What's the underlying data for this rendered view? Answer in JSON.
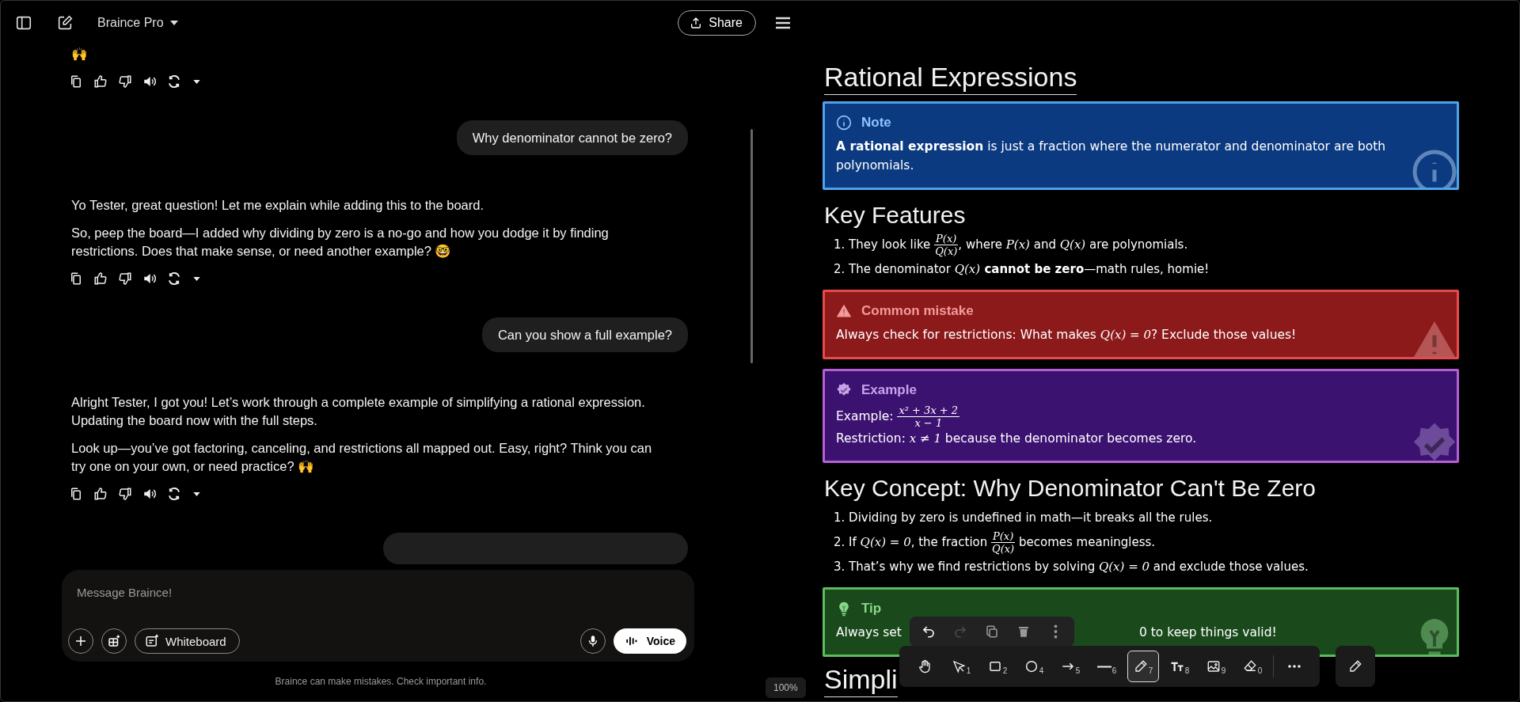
{
  "header": {
    "model": "Braince Pro",
    "share": "Share"
  },
  "messages": [
    {
      "kind": "assistant",
      "paragraphs": [
        "🙌"
      ]
    },
    {
      "kind": "user",
      "text": "Why denominator cannot be zero?"
    },
    {
      "kind": "assistant",
      "paragraphs": [
        "Yo Tester, great question! Let me explain while adding this to the board.",
        "So, peep the board—I added why dividing by zero is a no-go and how you dodge it by finding restrictions. Does that make sense, or need another example? 🤓"
      ]
    },
    {
      "kind": "user",
      "text": "Can you show a full example?"
    },
    {
      "kind": "assistant",
      "paragraphs": [
        "Alright Tester, I got you! Let’s work through a complete example of simplifying a rational expression. Updating the board now with the full steps.",
        "Look up—you’ve got factoring, canceling, and restrictions all mapped out. Easy, right? Think you can try one on your own, or need practice? 🙌"
      ]
    },
    {
      "kind": "user-cut"
    }
  ],
  "composer": {
    "placeholder": "Message Braince!",
    "whiteboard": "Whiteboard",
    "voice": "Voice"
  },
  "footer": "Braince can make mistakes. Check important info.",
  "zoom": "100%",
  "board": [
    {
      "kind": "title",
      "text": "Rational Expressions"
    },
    {
      "kind": "note",
      "title": "Note",
      "lines": [
        [
          {
            "kind": "bold",
            "text": "A rational expression"
          },
          {
            "kind": "text",
            "text": " is just a fraction where the numerator and denominator are both polynomials."
          }
        ]
      ]
    },
    {
      "kind": "heading",
      "text": "Key Features"
    },
    {
      "kind": "list",
      "items": [
        {
          "number": "1.",
          "segments": [
            {
              "kind": "text",
              "text": "They look like "
            },
            {
              "kind": "frac",
              "num": "P(x)",
              "den": "Q(x)"
            },
            {
              "kind": "text",
              "text": ", where "
            },
            {
              "kind": "math",
              "text": "P(x)"
            },
            {
              "kind": "text",
              "text": " and "
            },
            {
              "kind": "math",
              "text": "Q(x)"
            },
            {
              "kind": "text",
              "text": " are polynomials."
            }
          ]
        },
        {
          "number": "2.",
          "segments": [
            {
              "kind": "text",
              "text": "The denominator "
            },
            {
              "kind": "math",
              "text": "Q(x)"
            },
            {
              "kind": "bold",
              "text": "cannot be zero"
            },
            {
              "kind": "text",
              "text": "—math rules, homie!"
            }
          ]
        }
      ]
    },
    {
      "kind": "mistake",
      "title": "Common mistake",
      "lines": [
        [
          {
            "kind": "text",
            "text": "Always check for restrictions: What makes "
          },
          {
            "kind": "math",
            "text": "Q(x) = 0"
          },
          {
            "kind": "text",
            "text": "? Exclude those values!"
          }
        ]
      ]
    },
    {
      "kind": "example",
      "title": "Example",
      "lines": [
        [
          {
            "kind": "text",
            "text": "Example: "
          },
          {
            "kind": "frac",
            "num": "x² + 3x + 2",
            "den": "x − 1"
          }
        ],
        [
          {
            "kind": "text",
            "text": "Restriction: "
          },
          {
            "kind": "math",
            "text": "x ≠ 1"
          },
          {
            "kind": "text",
            "text": " because the denominator becomes zero."
          }
        ]
      ]
    },
    {
      "kind": "heading",
      "text": "Key Concept: Why Denominator Can't Be Zero"
    },
    {
      "kind": "list",
      "items": [
        {
          "number": "1.",
          "segments": [
            {
              "kind": "text",
              "text": "Dividing by zero is undefined in math—it breaks all the rules."
            }
          ]
        },
        {
          "number": "2.",
          "segments": [
            {
              "kind": "text",
              "text": "If "
            },
            {
              "kind": "math",
              "text": "Q(x) = 0"
            },
            {
              "kind": "text",
              "text": ", the fraction "
            },
            {
              "kind": "frac",
              "num": "P(x)",
              "den": "Q(x)"
            },
            {
              "kind": "text",
              "text": " becomes meaningless."
            }
          ]
        },
        {
          "number": "3.",
          "segments": [
            {
              "kind": "text",
              "text": "That’s why we find restrictions by solving "
            },
            {
              "kind": "math",
              "text": "Q(x) = 0"
            },
            {
              "kind": "text",
              "text": " and exclude those values."
            }
          ]
        }
      ]
    },
    {
      "kind": "tip",
      "title": "Tip",
      "lines": [
        [
          {
            "kind": "text",
            "text": "Always set"
          },
          {
            "kind": "gap"
          },
          {
            "kind": "text",
            "text": "0 to keep things valid!"
          }
        ]
      ]
    },
    {
      "kind": "title",
      "text": "Simpli"
    }
  ],
  "edit_actions": [
    {
      "kind": "undo",
      "disabled": false
    },
    {
      "kind": "redo",
      "disabled": true
    },
    {
      "kind": "copy",
      "disabled": false
    },
    {
      "kind": "delete",
      "disabled": false
    },
    {
      "kind": "more",
      "disabled": false
    }
  ],
  "tools": [
    {
      "kind": "hand",
      "selected": false
    },
    {
      "kind": "pointer",
      "key": "1",
      "selected": false
    },
    {
      "kind": "rectangle",
      "key": "2",
      "selected": false
    },
    {
      "kind": "ellipse",
      "key": "4",
      "selected": false
    },
    {
      "kind": "arrow",
      "key": "5",
      "selected": false
    },
    {
      "kind": "line",
      "key": "6",
      "selected": false
    },
    {
      "kind": "pencil",
      "key": "7",
      "selected": true
    },
    {
      "kind": "text",
      "key": "8",
      "selected": false
    },
    {
      "kind": "image",
      "key": "9",
      "selected": false
    },
    {
      "kind": "eraser",
      "key": "0",
      "selected": false
    }
  ]
}
